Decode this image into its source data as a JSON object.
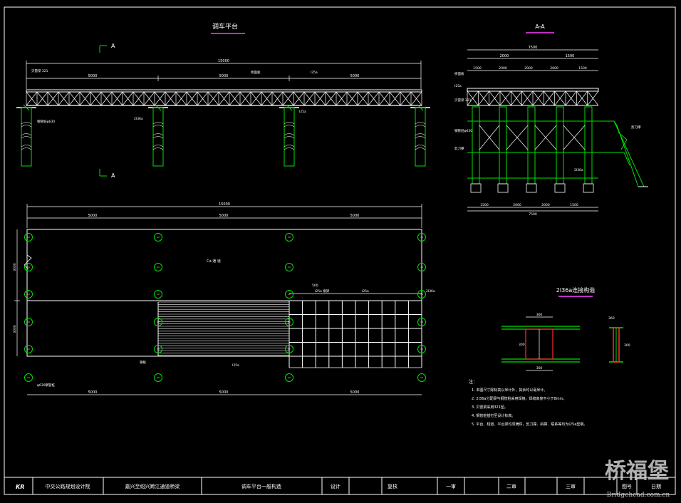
{
  "titles": {
    "elevation": "调车平台",
    "section": "A-A",
    "detail": "2I36a连接构造",
    "cut_a": "A"
  },
  "labels": {
    "beam_top": "贝雷梁 321",
    "deck": "桥面板",
    "cross_beam": "I25a",
    "pile_cap": "2I36a",
    "pile": "钢管桩φ630",
    "bracing": "剪刀撑",
    "plan_center": "Ca 通 道",
    "plan_slab": "钢板",
    "grid_label": "I25a 横梁",
    "pile_tag": "φ630钢管桩",
    "cut_tag": "I25a"
  },
  "dims": {
    "overall": "15000",
    "span1": "5000",
    "span2": "5000",
    "span3": "5000",
    "sec_overall": "7500",
    "sec_a": "1500",
    "sec_b": "2000",
    "sec_c": "2000",
    "sec_d": "2000",
    "sec_row": "1500",
    "plan_h1": "3000",
    "plan_h2": "3000",
    "grid_step": "500",
    "det_w": "360",
    "det_h": "300"
  },
  "notes": {
    "heading": "注：",
    "items": [
      "1. 本图尺寸除标高以米计外，其余均以毫米计。",
      "2. 2I36a分配梁与钢管桩采用焊接，焊缝高度不小于8mm。",
      "3. 贝雷梁采用321型。",
      "4. 钢管桩插打至设计标高。",
      "5. 平台、栈道、平台梁均须满焊，剪刀撑、斜撑、联系等均为I25a型钢。"
    ]
  },
  "title_block": {
    "logo": "KR",
    "company": "中交公路规划设计院",
    "project": "嘉兴至绍兴跨江通道桥梁",
    "drawing": "调车平台一般构造",
    "design": "设计",
    "check": "复核",
    "review1": "一审",
    "review2": "二审",
    "review3": "三审",
    "map_no": "图号",
    "date": "日期"
  },
  "watermark": {
    "brand": "桥福堡",
    "site": "Bridgehead.com.cn"
  },
  "colors": {
    "bg": "#000000",
    "line": "#ffffff",
    "green": "#00e000",
    "red": "#ff3030",
    "magenta": "#ff40ff",
    "cyan": "#00d8ff"
  }
}
